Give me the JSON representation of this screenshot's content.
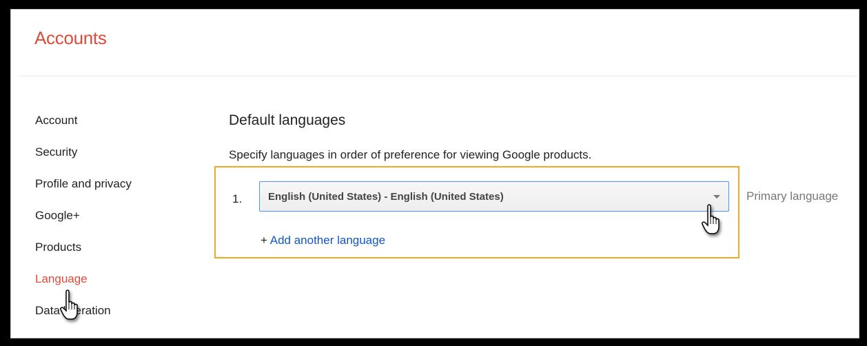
{
  "header": {
    "title": "Accounts"
  },
  "sidebar": {
    "items": [
      {
        "label": "Account"
      },
      {
        "label": "Security"
      },
      {
        "label": "Profile and privacy"
      },
      {
        "label": "Google+"
      },
      {
        "label": "Products"
      },
      {
        "label": "Language",
        "active": true
      },
      {
        "label": "Data liberation"
      }
    ]
  },
  "main": {
    "section_title": "Default languages",
    "description": "Specify languages in order of preference for viewing Google products.",
    "languages": [
      {
        "index": "1.",
        "value": "English (United States) - English (United States)",
        "tag": "Primary language"
      }
    ],
    "add_prefix": "+",
    "add_label": "Add another language"
  },
  "colors": {
    "brand": "#dd4b39",
    "link": "#1155cc",
    "highlight": "#f5a623",
    "select_border": "#4d90fe"
  },
  "icons": [
    "hand-pointer-cursor-icon",
    "dropdown-caret-icon"
  ]
}
